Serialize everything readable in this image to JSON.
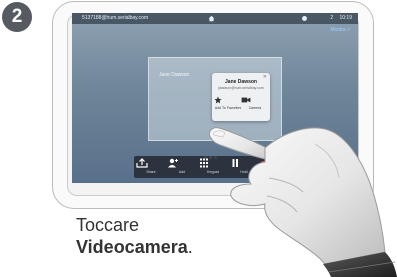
{
  "step_number": "2",
  "screen": {
    "status": {
      "sip_address": "5137188@hum.serialbay.com",
      "time": "10:19",
      "badge": "2"
    },
    "self_view_link": "Mostra >",
    "call_panel": {
      "remote_name": "Jane Dawson"
    },
    "popup": {
      "close": "✕",
      "name": "Jane Dawson",
      "uri": "jdawson@hum.serialbay.com",
      "actions": [
        {
          "label": "Add To Favorites",
          "icon": "star-icon"
        },
        {
          "label": "Camera",
          "icon": "video-camera-icon"
        }
      ]
    },
    "call_bar": [
      {
        "label": "Share",
        "icon": "share-tray-icon"
      },
      {
        "label": "Add",
        "icon": "add-participant-icon"
      },
      {
        "label": "Keypad",
        "icon": "keypad-icon"
      },
      {
        "label": "Hold",
        "icon": "pause-icon"
      },
      {
        "label": "End",
        "icon": "end-call-icon"
      }
    ],
    "pager": {
      "pages": 3,
      "active": 1
    }
  },
  "caption": {
    "line1": "Toccare",
    "bold": "Videocamera",
    "suffix": "."
  },
  "colors": {
    "badge": "#555b60",
    "screen": "#6f8699",
    "call_bar": "#23282f",
    "link": "#9ed0ff"
  }
}
